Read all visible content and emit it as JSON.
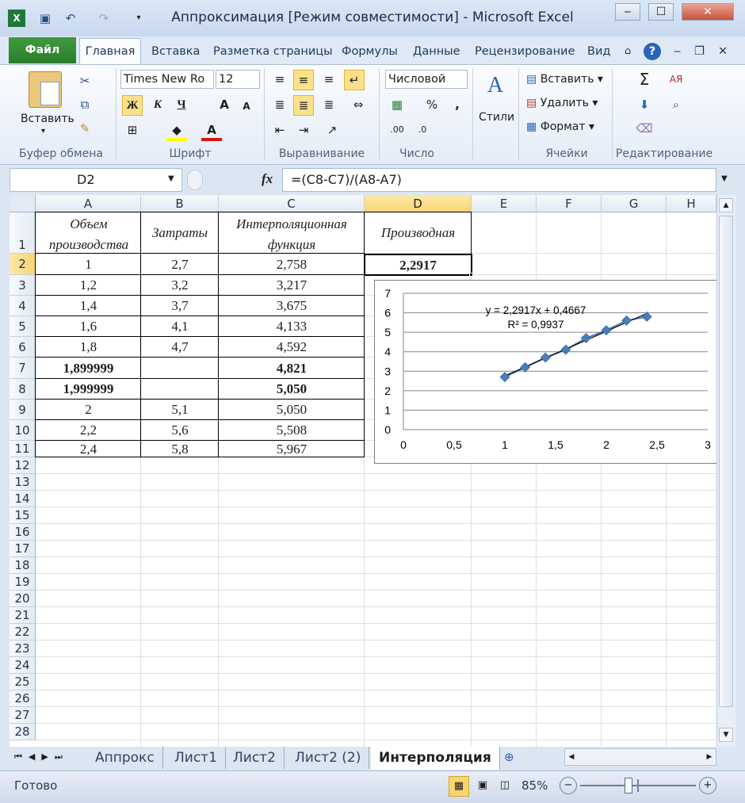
{
  "window": {
    "title": "Аппроксимация  [Режим совместимости] - Microsoft Excel"
  },
  "ribbon_tabs": [
    "Файл",
    "Главная",
    "Вставка",
    "Разметка страницы",
    "Формулы",
    "Данные",
    "Рецензирование",
    "Вид"
  ],
  "ribbon": {
    "clipboard": {
      "paste": "Вставить",
      "label": "Буфер обмена"
    },
    "font": {
      "name": "Times New Ro",
      "size": "12",
      "bold": "Ж",
      "italic": "К",
      "underline": "Ч",
      "label": "Шрифт"
    },
    "alignment": {
      "label": "Выравнивание"
    },
    "number": {
      "format": "Числовой",
      "label": "Число"
    },
    "styles": {
      "label": "Стили"
    },
    "cells": {
      "insert": "Вставить",
      "delete": "Удалить",
      "format": "Формат",
      "label": "Ячейки"
    },
    "editing": {
      "label": "Редактирование"
    }
  },
  "formula_bar": {
    "name_box": "D2",
    "fx": "fx",
    "formula": "=(C8-C7)/(A8-A7)"
  },
  "columns": [
    "A",
    "B",
    "C",
    "D",
    "E",
    "F",
    "G",
    "H"
  ],
  "rows": [
    "1",
    "2",
    "3",
    "4",
    "5",
    "6",
    "7",
    "8",
    "9",
    "10",
    "11",
    "12",
    "13",
    "14",
    "15",
    "16",
    "17",
    "18",
    "19",
    "20",
    "21",
    "22",
    "23",
    "24",
    "25",
    "26",
    "27",
    "28"
  ],
  "headers": {
    "a": [
      "Объем",
      "производства"
    ],
    "b": "Затраты",
    "c": [
      "Интерполяционная",
      "функция"
    ],
    "d": "Производная"
  },
  "table": [
    {
      "a": "1",
      "b": "2,7",
      "c": "2,758"
    },
    {
      "a": "1,2",
      "b": "3,2",
      "c": "3,217"
    },
    {
      "a": "1,4",
      "b": "3,7",
      "c": "3,675"
    },
    {
      "a": "1,6",
      "b": "4,1",
      "c": "4,133"
    },
    {
      "a": "1,8",
      "b": "4,7",
      "c": "4,592"
    },
    {
      "a": "1,899999",
      "b": "",
      "c": "4,821"
    },
    {
      "a": "1,999999",
      "b": "",
      "c": "5,050"
    },
    {
      "a": "2",
      "b": "5,1",
      "c": "5,050"
    },
    {
      "a": "2,2",
      "b": "5,6",
      "c": "5,508"
    },
    {
      "a": "2,4",
      "b": "5,8",
      "c": "5,967"
    }
  ],
  "derivative": "2,2917",
  "chart_data": {
    "type": "scatter",
    "x": [
      1,
      1.2,
      1.4,
      1.6,
      1.8,
      2,
      2.2,
      2.4
    ],
    "y": [
      2.7,
      3.2,
      3.7,
      4.1,
      4.7,
      5.1,
      5.6,
      5.8
    ],
    "trendline": {
      "slope": 2.2917,
      "intercept": 0.4667,
      "equation": "y = 2,2917x + 0,4667",
      "r2": "R² = 0,9937"
    },
    "xlim": [
      0,
      3
    ],
    "ylim": [
      0,
      7
    ],
    "xticks": [
      "0",
      "0,5",
      "1",
      "1,5",
      "2",
      "2,5",
      "3"
    ],
    "yticks": [
      "0",
      "1",
      "2",
      "3",
      "4",
      "5",
      "6",
      "7"
    ],
    "grid": "horizontal",
    "marker_color": "#4a7ebb"
  },
  "sheets": [
    "Аппрокс",
    "Лист1",
    "Лист2",
    "Лист2 (2)",
    "Интерполяция"
  ],
  "status": {
    "ready": "Готово",
    "zoom": "85%"
  }
}
